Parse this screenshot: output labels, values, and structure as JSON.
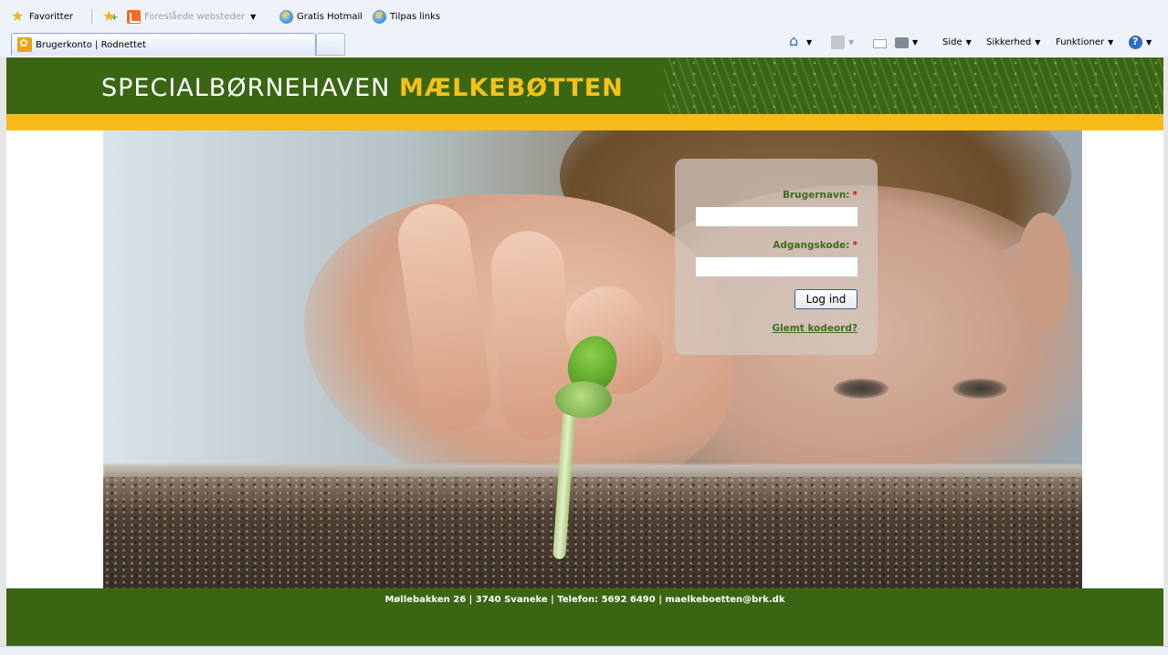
{
  "browser": {
    "favorites_bar": {
      "favorites_label": "Favoritter",
      "suggested_sites_label": "Foreslåede websteder",
      "hotmail_label": "Gratis Hotmail",
      "custom_links_label": "Tilpas links"
    },
    "tab": {
      "title": "Brugerkonto | Rodnettet"
    },
    "command_bar": {
      "page_label": "Side",
      "safety_label": "Sikkerhed",
      "tools_label": "Funktioner"
    }
  },
  "site": {
    "logo": {
      "part1": "SPECIALBØRNEHAVEN ",
      "part2": "MÆLKEBØTTEN"
    },
    "colors": {
      "header_green": "#3a6614",
      "accent_yellow": "#f7bb19",
      "label_green": "#3f6e1c"
    }
  },
  "login": {
    "username_label": "Brugernavn:",
    "username_value": "",
    "password_label": "Adgangskode:",
    "password_value": "",
    "required_marker": "*",
    "submit_label": "Log ind",
    "forgot_label": "Glemt kodeord?"
  },
  "footer": {
    "text": "Møllebakken 26 | 3740 Svaneke | Telefon: 5692 6490 | maelkeboetten@brk.dk"
  }
}
